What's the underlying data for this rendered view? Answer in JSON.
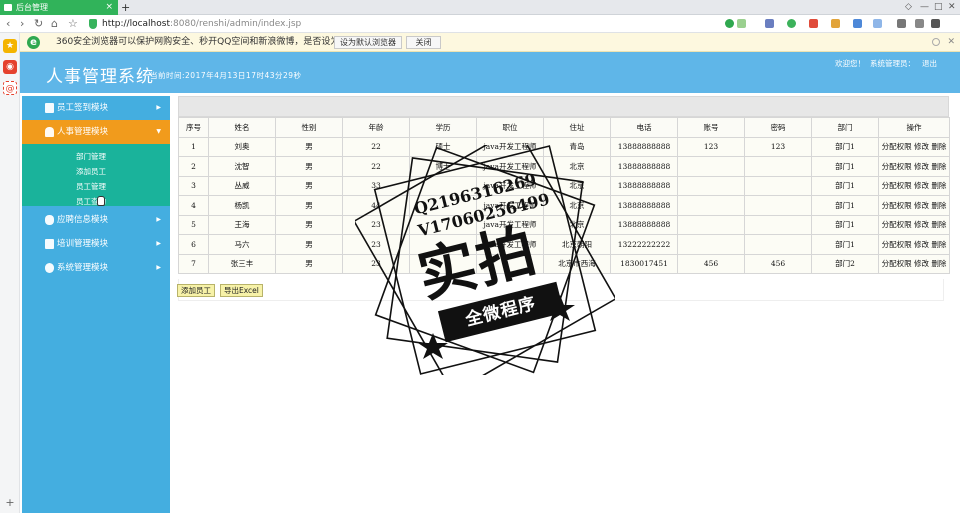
{
  "browser": {
    "tab_title": "后台管理",
    "url_host": "http://localhost",
    "url_rest": ":8080/renshi/admin/index.jsp",
    "infobar_text": "360安全浏览器可以保护网购安全、秒开QQ空间和新浪微博，是否设为默认？",
    "set_default_label": "设为默认浏览器",
    "close_label": "关闭"
  },
  "header": {
    "title": "人事管理系统",
    "current_time": "当前时间:2017年4月13日17时43分29秒",
    "welcome": "欢迎您！",
    "user": "系统管理员：",
    "logout": "退出"
  },
  "sidebar": {
    "modules": [
      {
        "label": "员工签到模块"
      },
      {
        "label": "人事管理模块"
      },
      {
        "label": "应聘信息模块"
      },
      {
        "label": "培训管理模块"
      },
      {
        "label": "系统管理模块"
      }
    ],
    "sub_items": [
      "部门管理",
      "添加员工",
      "员工管理",
      "员工查询"
    ]
  },
  "table": {
    "headers": [
      "序号",
      "姓名",
      "性别",
      "年龄",
      "学历",
      "职位",
      "住址",
      "电话",
      "账号",
      "密码",
      "部门",
      "操作"
    ],
    "rows": [
      [
        "1",
        "刘奥",
        "男",
        "22",
        "硕士",
        "java开发工程师",
        "青岛",
        "13888888888",
        "123",
        "123",
        "部门1",
        "分配权限 修改 删除"
      ],
      [
        "2",
        "沈智",
        "男",
        "22",
        "博士",
        "java开发工程师",
        "北京",
        "13888888888",
        "",
        "",
        "部门1",
        "分配权限 修改 删除"
      ],
      [
        "3",
        "丛威",
        "男",
        "33",
        "",
        "java开发工程师",
        "北京",
        "13888888888",
        "",
        "",
        "部门1",
        "分配权限 修改 删除"
      ],
      [
        "4",
        "杨凯",
        "男",
        "44",
        "",
        "java开发工程师",
        "北京",
        "13888888888",
        "",
        "",
        "部门1",
        "分配权限 修改 删除"
      ],
      [
        "5",
        "王海",
        "男",
        "23",
        "",
        "java开发工程师",
        "北京",
        "13888888888",
        "",
        "",
        "部门1",
        "分配权限 修改 删除"
      ],
      [
        "6",
        "马六",
        "男",
        "23",
        "",
        "java开发工程师",
        "北京朝阳",
        "13222222222",
        "",
        "",
        "部门1",
        "分配权限 修改 删除"
      ],
      [
        "7",
        "张三丰",
        "男",
        "23",
        "",
        "",
        "北京市西海",
        "1830017451",
        "456",
        "456",
        "部门2",
        "分配权限 修改 删除"
      ]
    ]
  },
  "actions": {
    "add_label": "添加员工",
    "export_label": "导出Excel"
  },
  "watermark": {
    "line1": "Q2196316269",
    "line2": "V17060256499",
    "big": "实拍",
    "ribbon": "全微程序"
  }
}
